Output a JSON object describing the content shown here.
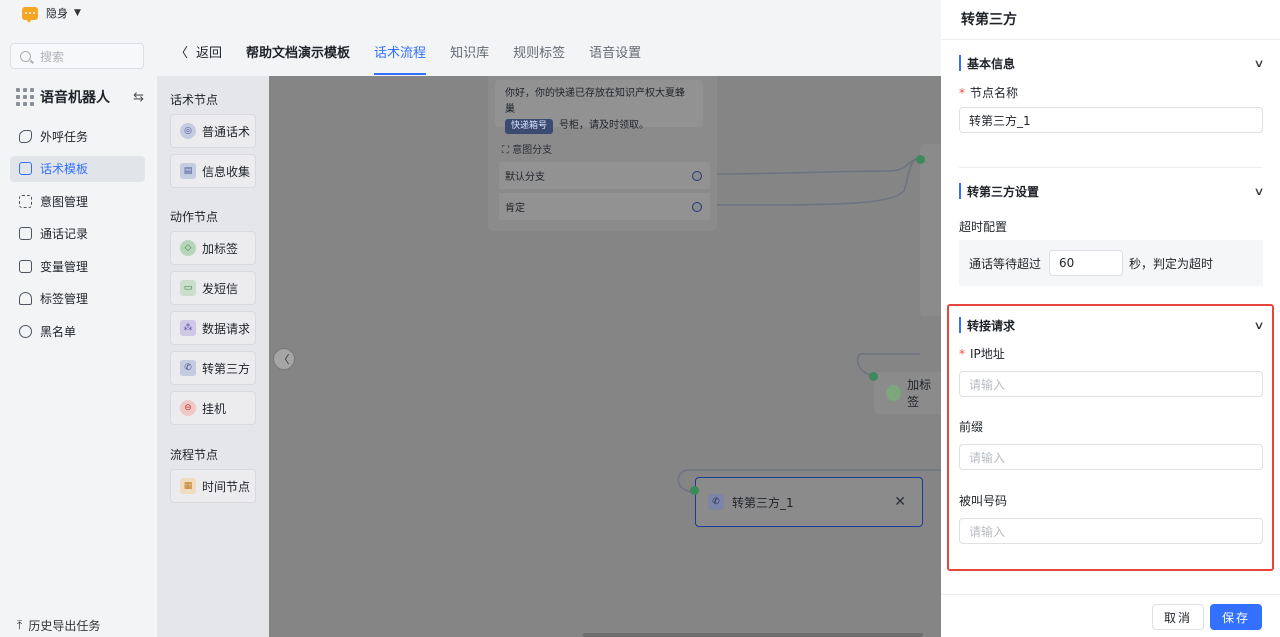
{
  "topbar": {
    "status": "隐身"
  },
  "sidebar": {
    "search_placeholder": "搜索",
    "app_title": "语音机器人",
    "items": [
      {
        "label": "外呼任务"
      },
      {
        "label": "话术模板"
      },
      {
        "label": "意图管理"
      },
      {
        "label": "通话记录"
      },
      {
        "label": "变量管理"
      },
      {
        "label": "标签管理"
      },
      {
        "label": "黑名单"
      }
    ],
    "footer": "历史导出任务"
  },
  "header": {
    "back_label": "返回",
    "template_name": "帮助文档演示模板",
    "tabs": [
      {
        "label": "话术流程"
      },
      {
        "label": "知识库"
      },
      {
        "label": "规则标签"
      },
      {
        "label": "语音设置"
      }
    ]
  },
  "palette": {
    "sections": [
      {
        "title": "话术节点",
        "items": [
          "普通话术",
          "信息收集"
        ]
      },
      {
        "title": "动作节点",
        "items": [
          "加标签",
          "发短信",
          "数据请求",
          "转第三方",
          "挂机"
        ]
      },
      {
        "title": "流程节点",
        "items": [
          "时间节点"
        ]
      }
    ]
  },
  "canvas": {
    "node_message_line1": "你好，你的快递已存放在知识产权大夏蜂巢",
    "node_message_chip": "快递箱号",
    "node_message_line2": "号柜，请及时领取。",
    "intent_label": "意图分支",
    "branches": [
      "默认分支",
      "肯定"
    ],
    "tag_node_label": "加标签",
    "selected_node_label": "转第三方_1"
  },
  "drawer": {
    "title": "转第三方",
    "basic_section": "基本信息",
    "node_name_label": "节点名称",
    "node_name_value": "转第三方_1",
    "settings_section": "转第三方设置",
    "timeout_label": "超时配置",
    "timeout_prefix": "通话等待超过",
    "timeout_value": "60",
    "timeout_suffix": "秒，判定为超时",
    "transfer_section": "转接请求",
    "ip_label": "IP地址",
    "ip_placeholder": "请输入",
    "prefix_label": "前缀",
    "prefix_placeholder": "请输入",
    "callee_label": "被叫号码",
    "callee_placeholder": "请输入",
    "cancel_label": "取消",
    "save_label": "保存"
  },
  "colors": {
    "accent": "#3370ff",
    "highlight": "#e8453c",
    "required": "#f54a45"
  }
}
